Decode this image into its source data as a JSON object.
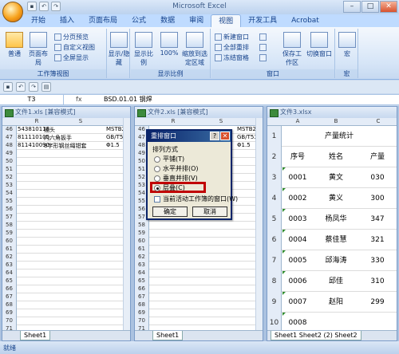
{
  "app": {
    "title": "Microsoft Excel"
  },
  "ribbon_tabs": [
    "开始",
    "插入",
    "页面布局",
    "公式",
    "数据",
    "审阅",
    "视图",
    "开发工具",
    "Acrobat"
  ],
  "ribbon": {
    "workbook_views": {
      "normal": "普通",
      "page_layout": "页面布局",
      "page_break": "分页预览",
      "custom": "自定义视图",
      "full_screen": "全屏显示",
      "group_label": "工作簿视图"
    },
    "show_hide": {
      "label": "显示/隐藏"
    },
    "zoom": {
      "zoom": "显示比例",
      "hundred": "100%",
      "zoom_selection": "缩放到选定区域",
      "group_label": "显示比例"
    },
    "window": {
      "new_window": "新建窗口",
      "arrange_all": "全部重排",
      "freeze": "冻结窗格",
      "save_ws": "保存工作区",
      "switch": "切换窗口",
      "group_label": "窗口"
    },
    "macro": {
      "label": "宏",
      "group_label": "宏"
    }
  },
  "formula_bar": {
    "name_box": "T3",
    "fx": "fx",
    "formula": "BSD.01.01 钢焊"
  },
  "window1": {
    "title": "文件1.xls [兼容模式]",
    "columns": [
      "R",
      "S"
    ],
    "rows": [
      {
        "n": "46",
        "a": "543810118",
        "b": "插头",
        "c": "MSTB2.5/"
      },
      {
        "n": "47",
        "a": "811110105",
        "b": "内六角扳手",
        "c": "GB/T5356"
      },
      {
        "n": "48",
        "a": "811410090",
        "b": "8字形钢丝绳钳套",
        "c": "Φ1.5"
      },
      {
        "n": "49"
      },
      {
        "n": "50"
      },
      {
        "n": "51"
      },
      {
        "n": "52"
      },
      {
        "n": "53"
      },
      {
        "n": "54"
      },
      {
        "n": "55"
      },
      {
        "n": "56"
      },
      {
        "n": "57"
      },
      {
        "n": "58"
      },
      {
        "n": "59"
      },
      {
        "n": "60"
      },
      {
        "n": "61"
      },
      {
        "n": "62"
      },
      {
        "n": "63"
      },
      {
        "n": "64"
      },
      {
        "n": "65"
      },
      {
        "n": "66"
      },
      {
        "n": "67"
      },
      {
        "n": "68"
      },
      {
        "n": "69"
      },
      {
        "n": "70"
      },
      {
        "n": "71"
      }
    ],
    "sheet": "Sheet1"
  },
  "window2": {
    "title": "文件2.xls [兼容模式]",
    "columns": [
      "R",
      "S"
    ],
    "rows": [
      {
        "n": "46",
        "c": "MSTB2.5/"
      },
      {
        "n": "47",
        "c": "GB/T5356"
      },
      {
        "n": "48",
        "c": "Φ1.5"
      },
      {
        "n": "49"
      },
      {
        "n": "50"
      },
      {
        "n": "51"
      },
      {
        "n": "52"
      },
      {
        "n": "53"
      },
      {
        "n": "54"
      },
      {
        "n": "55"
      },
      {
        "n": "56"
      },
      {
        "n": "57"
      },
      {
        "n": "58"
      },
      {
        "n": "59"
      },
      {
        "n": "60"
      },
      {
        "n": "61"
      },
      {
        "n": "62"
      },
      {
        "n": "63"
      },
      {
        "n": "64"
      },
      {
        "n": "65"
      },
      {
        "n": "66"
      },
      {
        "n": "67"
      },
      {
        "n": "68"
      },
      {
        "n": "69"
      },
      {
        "n": "70"
      },
      {
        "n": "71"
      }
    ],
    "sheet": "Sheet1"
  },
  "window3": {
    "title": "文件3.xlsx",
    "columns": [
      "A",
      "B",
      "C"
    ],
    "heading": "产量统计",
    "header_row": {
      "a": "序号",
      "b": "姓名",
      "c": "产量"
    },
    "rows": [
      {
        "n": "1"
      },
      {
        "n": "2"
      },
      {
        "n": "3",
        "a": "0001",
        "b": "黄文",
        "c": "030"
      },
      {
        "n": "4",
        "a": "0002",
        "b": "黄义",
        "c": "300"
      },
      {
        "n": "5",
        "a": "0003",
        "b": "杨凤华",
        "c": "347"
      },
      {
        "n": "6",
        "a": "0004",
        "b": "蔡佳慧",
        "c": "321"
      },
      {
        "n": "7",
        "a": "0005",
        "b": "邱海涛",
        "c": "330"
      },
      {
        "n": "8",
        "a": "0006",
        "b": "邱佳",
        "c": "310"
      },
      {
        "n": "9",
        "a": "0007",
        "b": "赵阳",
        "c": "299"
      },
      {
        "n": "10",
        "a": "0008",
        "b": "",
        "c": ""
      }
    ],
    "sheets": "Sheet1 Sheet2 (2) Sheet2"
  },
  "dialog": {
    "title": "重排窗口",
    "help": "?",
    "close": "✕",
    "group_label": "排列方式",
    "options": [
      "平铺(T)",
      "水平并排(O)",
      "垂直并排(V)",
      "层叠(C)"
    ],
    "selected": 3,
    "checkbox": "当前活动工作簿的窗口(W)",
    "ok": "确定",
    "cancel": "取消"
  },
  "status": {
    "text": "就绪"
  }
}
